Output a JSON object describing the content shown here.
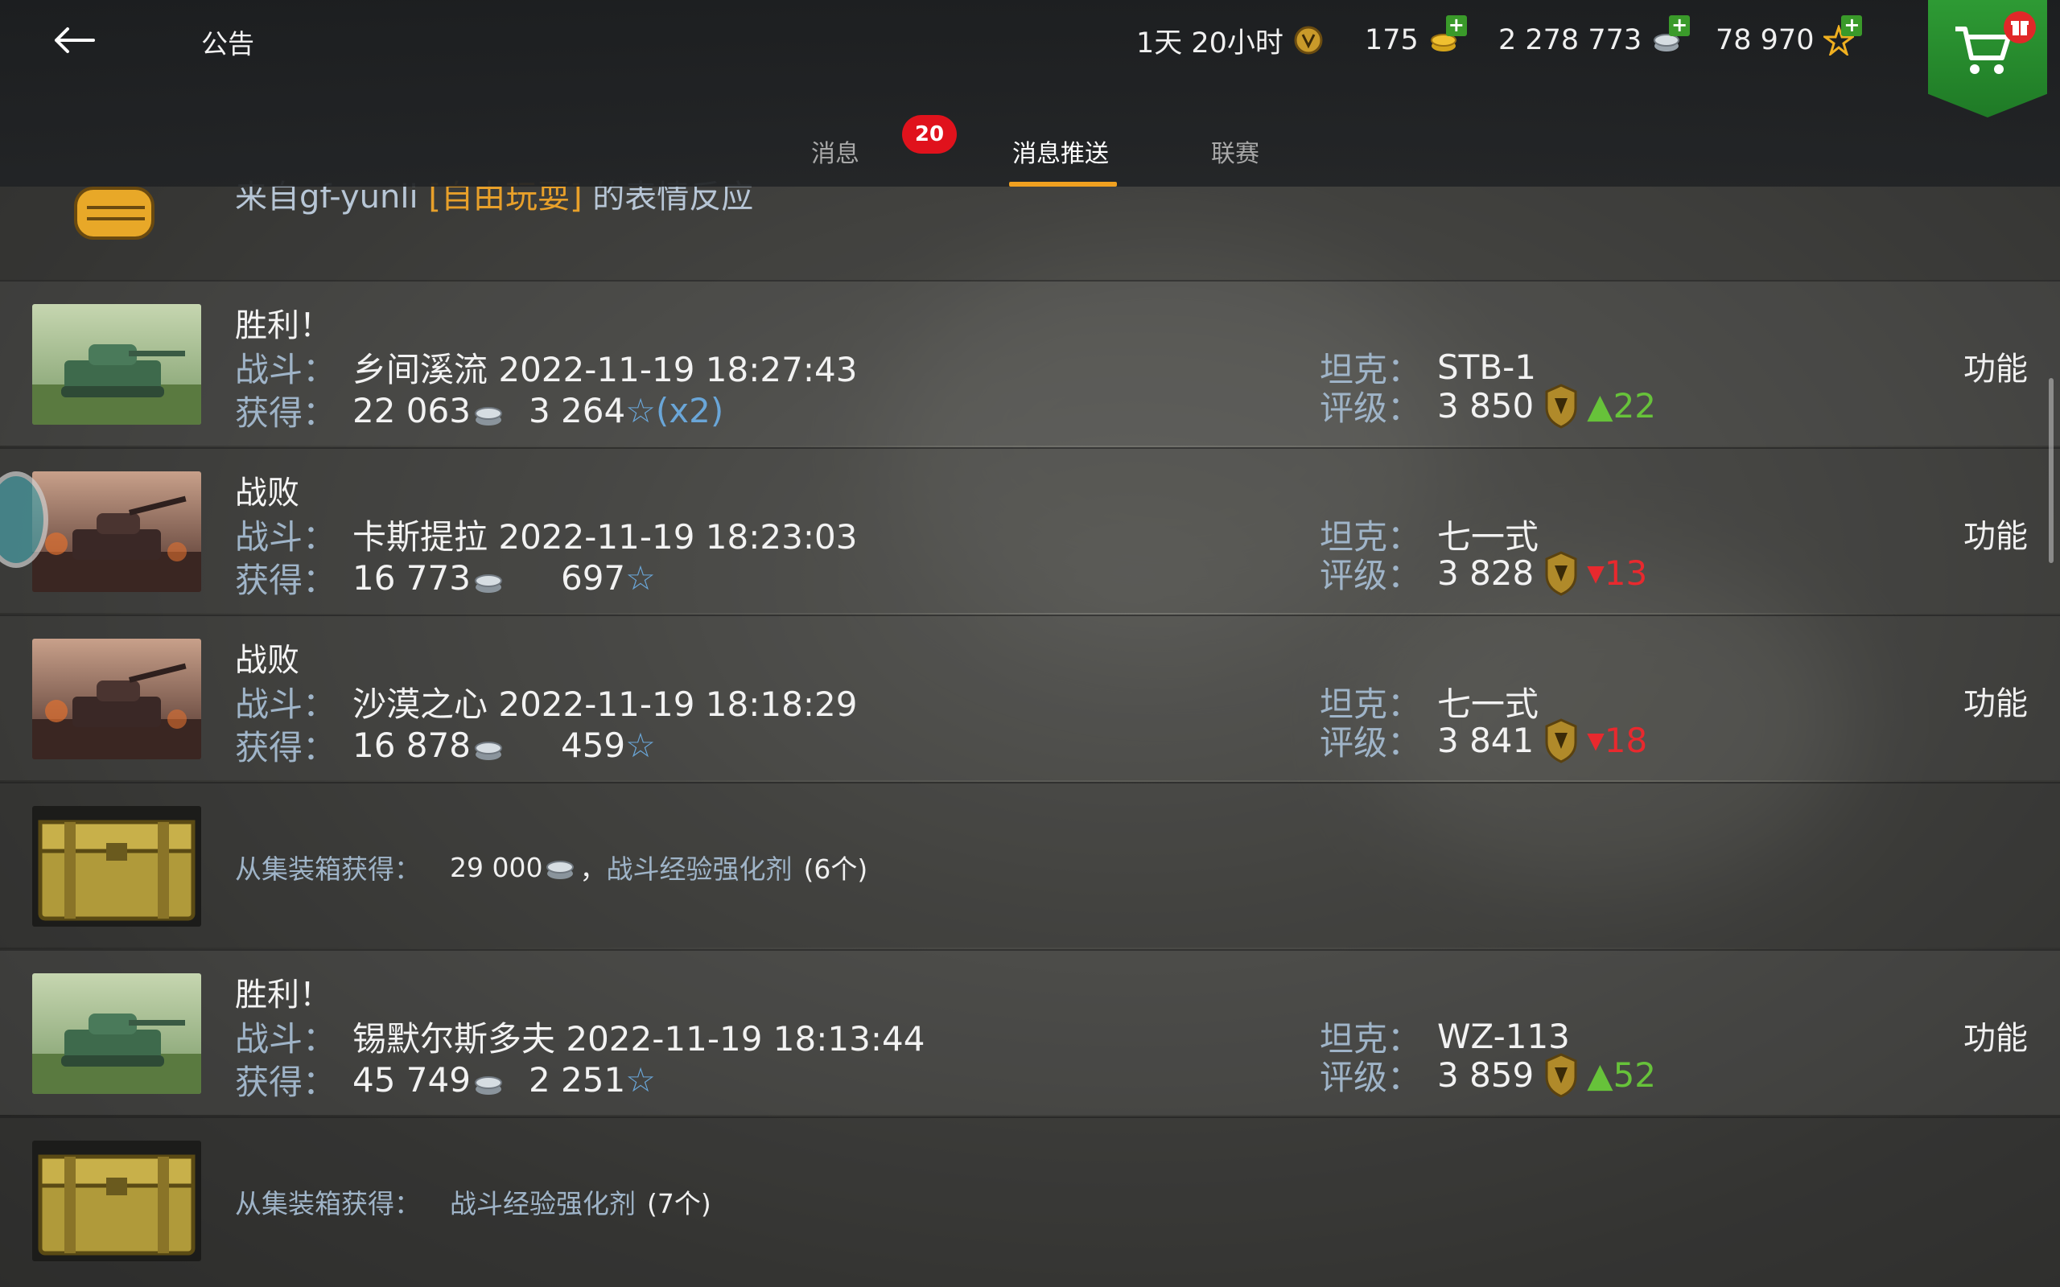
{
  "header": {
    "title": "公告",
    "timer": "1天 20小时",
    "gold": "175",
    "credits": "2 278 773",
    "free_xp": "78 970"
  },
  "tabs": [
    {
      "label": "消息",
      "badge": "20"
    },
    {
      "label": "消息推送"
    },
    {
      "label": "联赛"
    }
  ],
  "partial_item": {
    "prefix": "来自gf-yunli ",
    "clan": "[自由玩耍]",
    "suffix": " 的表情反应"
  },
  "labels": {
    "battle": "战斗：",
    "earned": "获得：",
    "tank": "坦克：",
    "rating": "评级：",
    "function": "功能",
    "chest_from": "从集装箱获得："
  },
  "battles": [
    {
      "result": "胜利！",
      "map_time": "乡间溪流 2022-11-19 18:27:43",
      "credits": "22 063",
      "xp": "3 264",
      "xp_mult": "(x2)",
      "tank": "STB-1",
      "rating": "3 850",
      "delta": "22",
      "dir": "up"
    },
    {
      "result": "战败",
      "map_time": "卡斯提拉 2022-11-19 18:23:03",
      "credits": "16 773",
      "xp": "697",
      "xp_mult": "",
      "tank": "七一式",
      "rating": "3 828",
      "delta": "13",
      "dir": "down"
    },
    {
      "result": "战败",
      "map_time": "沙漠之心 2022-11-19 18:18:29",
      "credits": "16 878",
      "xp": "459",
      "xp_mult": "",
      "tank": "七一式",
      "rating": "3 841",
      "delta": "18",
      "dir": "down"
    },
    {
      "result": "胜利！",
      "map_time": "锡默尔斯多夫 2022-11-19 18:13:44",
      "credits": "45 749",
      "xp": "2 251",
      "xp_mult": "",
      "tank": "WZ-113",
      "rating": "3 859",
      "delta": "52",
      "dir": "up"
    }
  ],
  "chests": [
    {
      "credits": "29 000",
      "sep": "，",
      "item": "战斗经验强化剂",
      "count": "(6个)"
    },
    {
      "item": "战斗经验强化剂",
      "count": "(7个)"
    }
  ],
  "colors": {
    "accent": "#f0a020",
    "up": "#67c23a",
    "down": "#e8292e",
    "badge": "#e0121c",
    "cart": "#2e9a34"
  }
}
